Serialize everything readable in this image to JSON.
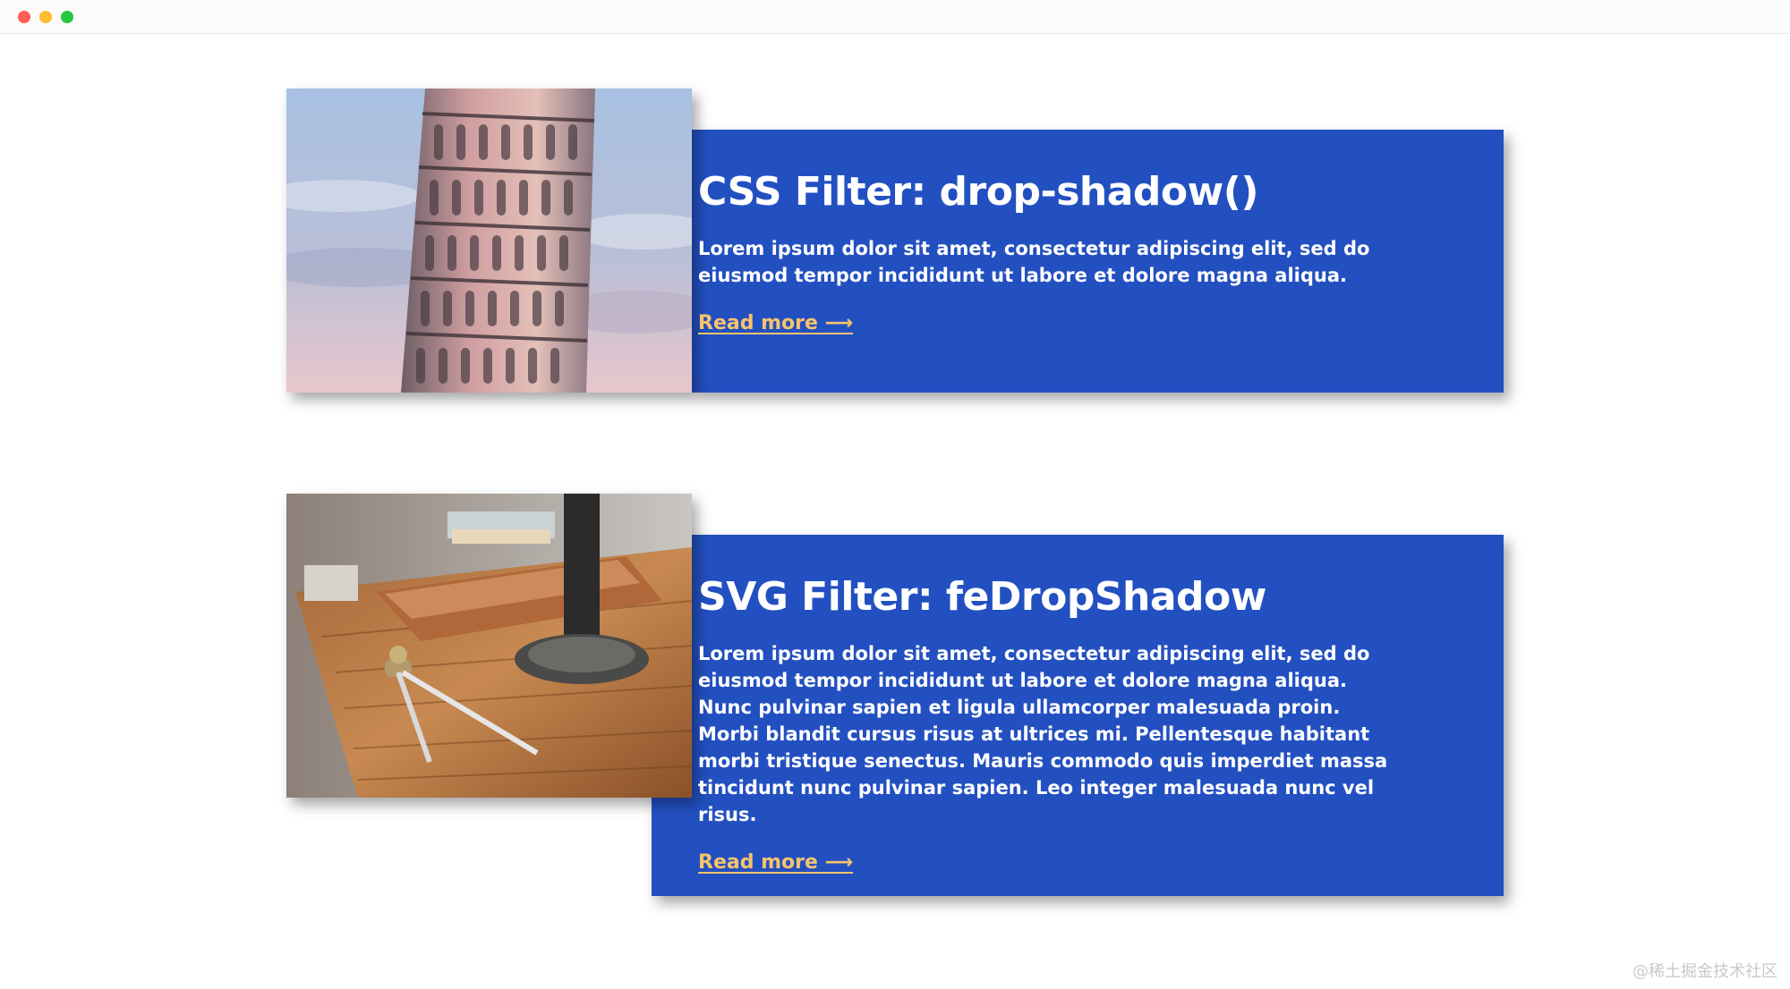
{
  "cards": [
    {
      "title": "CSS Filter: drop-shadow()",
      "body": "Lorem ipsum dolor sit amet, consectetur adipiscing elit, sed do eiusmod tempor incididunt ut labore et dolore magna aliqua.",
      "read_more": "Read more ⟶"
    },
    {
      "title": "SVG Filter: feDropShadow",
      "body": "Lorem ipsum dolor sit amet, consectetur adipiscing elit, sed do eiusmod tempor incididunt ut labore et dolore magna aliqua. Nunc pulvinar sapien et ligula ullamcorper malesuada proin. Morbi blandit cursus risus at ultrices mi. Pellentesque habitant morbi tristique senectus. Mauris commodo quis imperdiet massa tincidunt nunc pulvinar sapien. Leo integer malesuada nunc vel risus.",
      "read_more": "Read more ⟶"
    }
  ],
  "watermark": "@稀土掘金技术社区",
  "colors": {
    "panel": "#2350c1",
    "link": "#f6c36d",
    "text": "#ffffff"
  }
}
